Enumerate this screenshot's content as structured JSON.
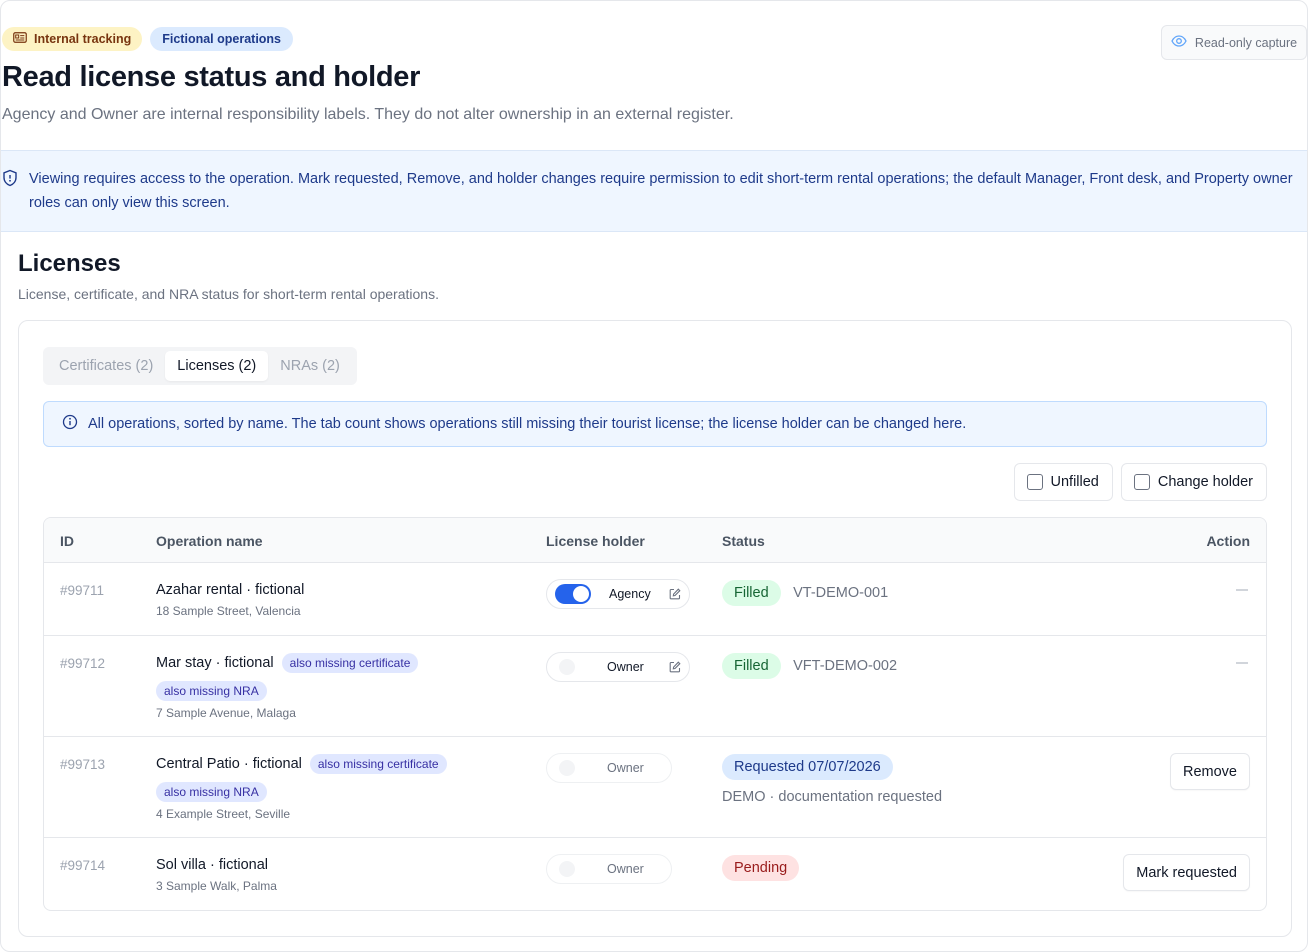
{
  "header": {
    "badge_tracking": "Internal tracking",
    "badge_fictional": "Fictional operations",
    "title": "Read license status and holder",
    "subtitle": "Agency and Owner are internal responsibility labels. They do not alter ownership in an external register.",
    "readonly_label": "Read-only capture"
  },
  "permission_banner": "Viewing requires access to the operation. Mark requested, Remove, and holder changes require permission to edit short-term rental operations; the default Manager, Front desk, and Property owner roles can only view this screen.",
  "section": {
    "title": "Licenses",
    "subtitle": "License, certificate, and NRA status for short-term rental operations."
  },
  "tabs": [
    {
      "label": "Certificates (2)",
      "active": false
    },
    {
      "label": "Licenses (2)",
      "active": true
    },
    {
      "label": "NRAs (2)",
      "active": false
    }
  ],
  "info_banner": "All operations, sorted by name. The tab count shows operations still missing their tourist license; the license holder can be changed here.",
  "filters": {
    "unfilled": "Unfilled",
    "change_holder": "Change holder"
  },
  "table": {
    "columns": {
      "id": "ID",
      "operation": "Operation name",
      "holder": "License holder",
      "status": "Status",
      "action": "Action"
    },
    "rows": [
      {
        "id": "#99711",
        "name": "Azahar rental · fictional",
        "tags": [],
        "address": "18 Sample Street, Valencia",
        "holder": "Agency",
        "holder_on": true,
        "status": "Filled",
        "reference": "VT-DEMO-001",
        "note": "",
        "action": ""
      },
      {
        "id": "#99712",
        "name": "Mar stay · fictional",
        "tags": [
          "also missing certificate",
          "also missing NRA"
        ],
        "address": "7 Sample Avenue, Malaga",
        "holder": "Owner",
        "holder_on": false,
        "status": "Filled",
        "reference": "VFT-DEMO-002",
        "note": "",
        "action": ""
      },
      {
        "id": "#99713",
        "name": "Central Patio · fictional",
        "tags": [
          "also missing certificate",
          "also missing NRA"
        ],
        "address": "4 Example Street, Seville",
        "holder": "Owner",
        "holder_on": false,
        "status": "Requested 07/07/2026",
        "reference": "",
        "note": "DEMO · documentation requested",
        "action": "Remove"
      },
      {
        "id": "#99714",
        "name": "Sol villa · fictional",
        "tags": [],
        "address": "3 Sample Walk, Palma",
        "holder": "Owner",
        "holder_on": false,
        "status": "Pending",
        "reference": "",
        "note": "",
        "action": "Mark requested"
      }
    ]
  }
}
